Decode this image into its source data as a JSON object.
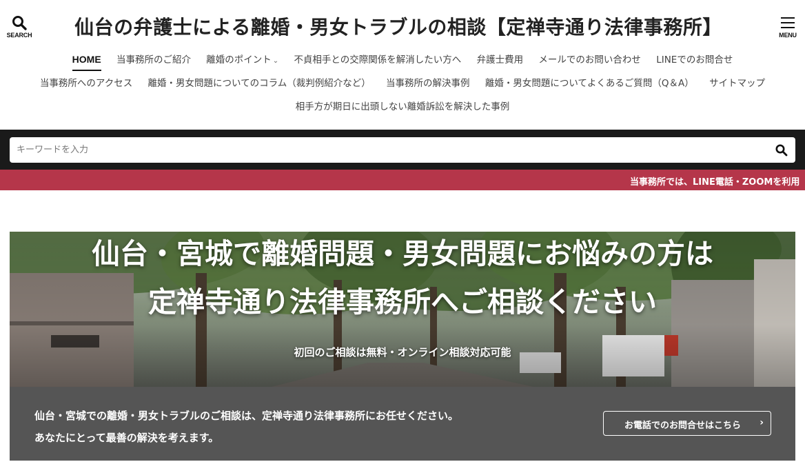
{
  "header": {
    "search_caption": "SEARCH",
    "menu_caption": "MENU",
    "site_title": "仙台の弁護士による離婚・男女トラブルの相談【定禅寺通り法律事務所】"
  },
  "nav": {
    "row1": [
      {
        "label": "HOME",
        "active": true
      },
      {
        "label": "当事務所のご紹介"
      },
      {
        "label": "離婚のポイント",
        "has_dropdown": true
      },
      {
        "label": "不貞相手との交際関係を解消したい方へ"
      },
      {
        "label": "弁護士費用"
      },
      {
        "label": "メールでのお問い合わせ"
      },
      {
        "label": "LINEでのお問合せ"
      }
    ],
    "row2": [
      {
        "label": "当事務所へのアクセス"
      },
      {
        "label": "離婚・男女問題についてのコラム（裁判例紹介など）"
      },
      {
        "label": "当事務所の解決事例"
      },
      {
        "label": "離婚・男女問題についてよくあるご質問（Q＆A）"
      },
      {
        "label": "サイトマップ"
      }
    ],
    "row3": [
      {
        "label": "相手方が期日に出頭しない離婚訴訟を解決した事例"
      }
    ],
    "dropdown_icon": "chevron-down-icon"
  },
  "search": {
    "placeholder": "キーワードを入力",
    "value": ""
  },
  "ticker": {
    "text": "当事務所では、LINE電話・ZOOMを利用",
    "color": "#b5364a"
  },
  "hero": {
    "title_line1": "仙台・宮城で離婚問題・男女問題にお悩みの方は",
    "title_line2": "定禅寺通り法律事務所へご相談ください",
    "subtitle": "初回のご相談は無料・オンライン相談対応可能"
  },
  "info": {
    "line1": "仙台・宮城での離婚・男女トラブルのご相談は、定禅寺通り法律事務所にお任せください。",
    "line2": "あなたにとって最善の解決を考えます。",
    "button_label": "お電話でのお問合せはこちら",
    "button_arrow": "›"
  },
  "colors": {
    "header_bg": "#ffffff",
    "search_band": "#1a1a1a",
    "ticker_bg": "#b5364a",
    "info_bg": "#555555"
  }
}
